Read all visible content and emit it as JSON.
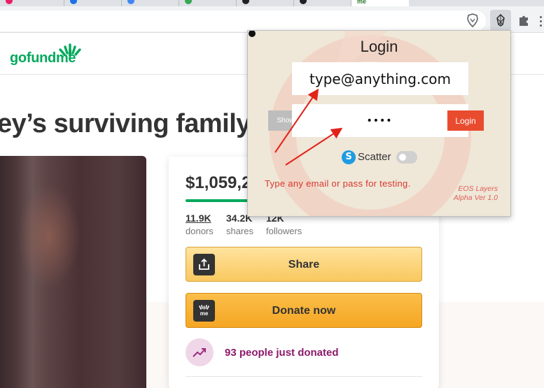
{
  "browser": {
    "active_tab_label": "me",
    "tab_favicon_colors": [
      "#e91e63",
      "#1a73e8",
      "#4285f4",
      "#34a853",
      "#202124",
      "#202124"
    ]
  },
  "page": {
    "logo_text": "gofundme",
    "headline": "ey’s surviving family",
    "donation_card": {
      "amount": "$1,059,2",
      "progress_fraction": 0.93,
      "stats": [
        {
          "value": "11.9K",
          "label": "donors"
        },
        {
          "value": "34.2K",
          "label": "shares"
        },
        {
          "value": "12K",
          "label": "followers"
        }
      ],
      "share_label": "Share",
      "donate_label": "Donate now",
      "donate_icon_text": "me",
      "recent_text": "93 people just donated"
    }
  },
  "popup": {
    "title": "Login",
    "email_value": "type@anything.com",
    "password_value": "••••",
    "show_label": "Show",
    "login_label": "Login",
    "scatter_label": "Scatter",
    "scatter_enabled": false,
    "test_note": "Type any email or pass for testing.",
    "version_line1": "EOS Layers",
    "version_line2": "Alpha Ver 1.0"
  },
  "colors": {
    "brand_green": "#02a95c",
    "donate_orange": "#f5a623",
    "login_red": "#e94b2e",
    "annotation_red": "#e2231a",
    "popup_bg": "#efe7d8"
  }
}
